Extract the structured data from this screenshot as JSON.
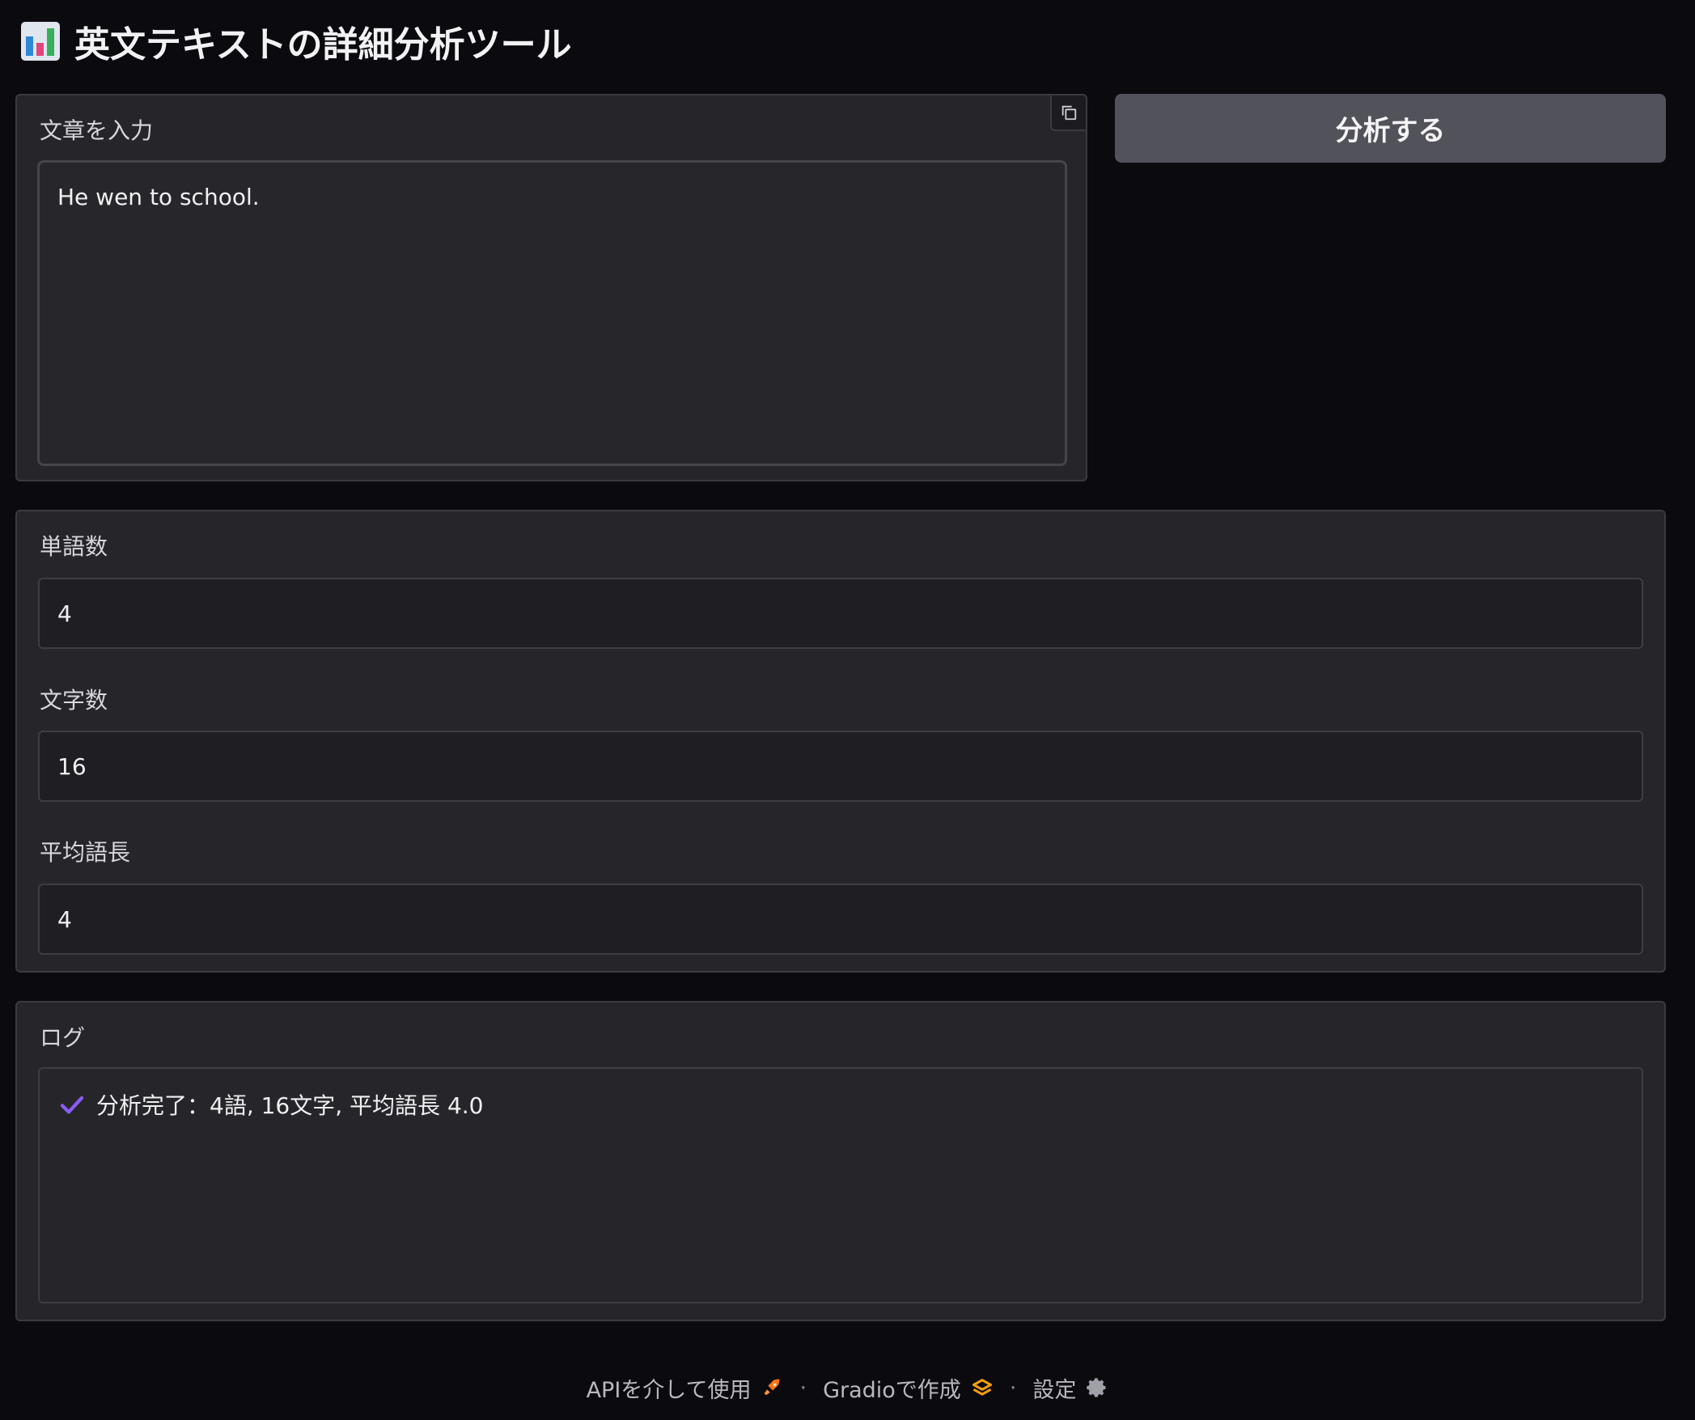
{
  "header": {
    "title": "英文テキストの詳細分析ツール",
    "icon": "bar-chart-icon"
  },
  "input": {
    "label": "文章を入力",
    "value": "He wen to school."
  },
  "actions": {
    "analyze_label": "分析する"
  },
  "stats": {
    "word_count_label": "単語数",
    "word_count_value": "4",
    "char_count_label": "文字数",
    "char_count_value": "16",
    "avg_len_label": "平均語長",
    "avg_len_value": "4"
  },
  "log": {
    "label": "ログ",
    "message": "分析完了：4語, 16文字, 平均語長 4.0"
  },
  "footer": {
    "api_label": "APIを介して使用",
    "gradio_label": "Gradioで作成",
    "settings_label": "設定",
    "separator": "·"
  },
  "colors": {
    "accent_check": "#8b5cf6",
    "api_icon": "#f97316",
    "gradio_icon": "#f59e0b"
  }
}
